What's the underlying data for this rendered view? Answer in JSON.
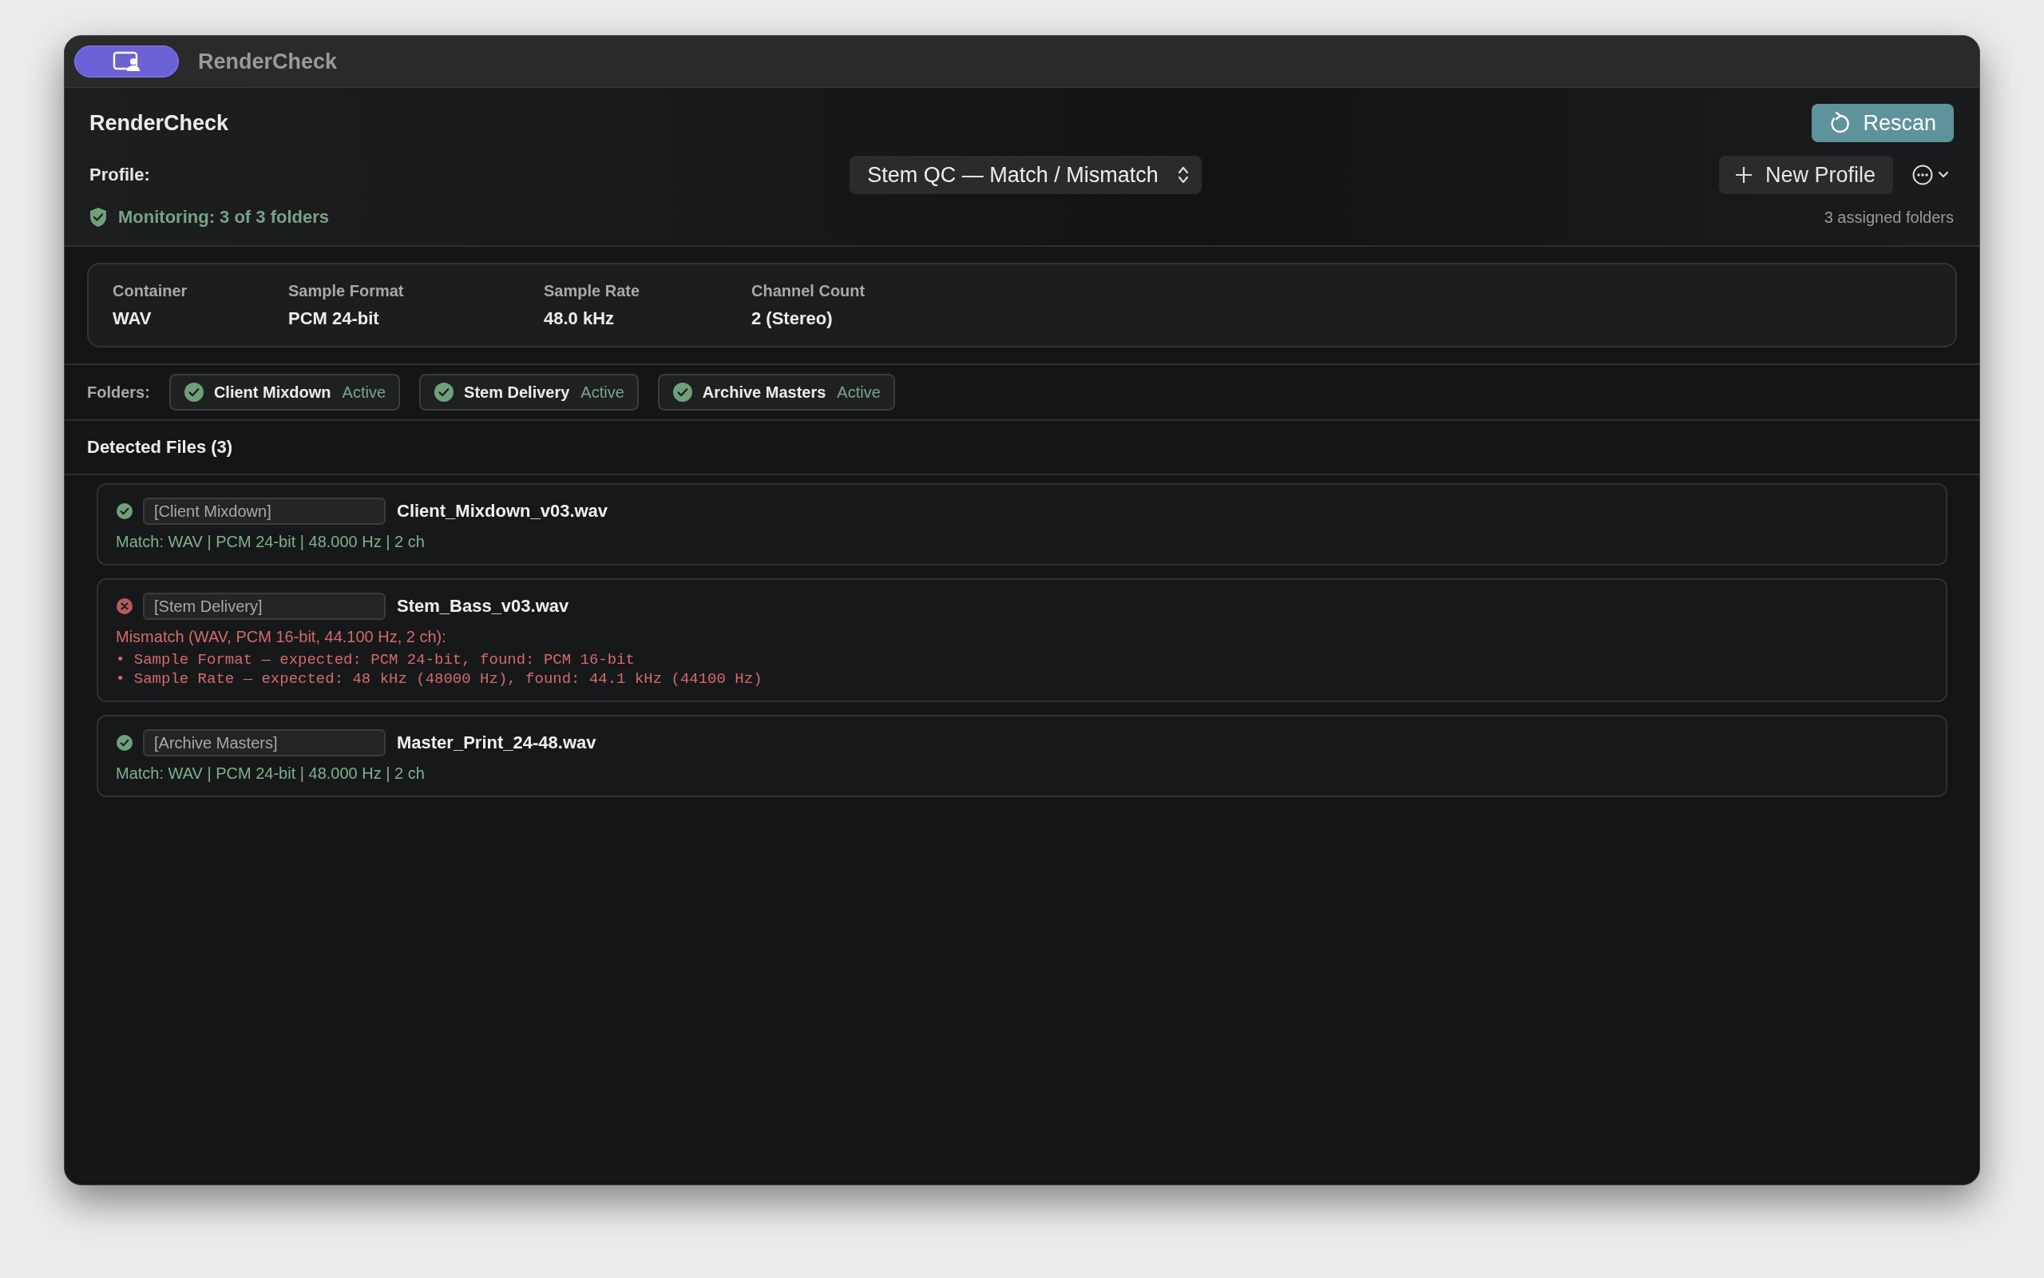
{
  "window": {
    "title": "RenderCheck"
  },
  "header": {
    "title": "RenderCheck",
    "rescan_button": "Rescan",
    "profile_label": "Profile:",
    "profile_select": "Stem QC — Match / Mismatch",
    "new_profile_button": "New Profile",
    "monitoring": "Monitoring: 3 of 3 folders",
    "assigned_count": "3 assigned folders"
  },
  "format": [
    {
      "label": "Container",
      "value": "WAV"
    },
    {
      "label": "Sample Format",
      "value": "PCM 24-bit"
    },
    {
      "label": "Sample Rate",
      "value": "48.0 kHz"
    },
    {
      "label": "Channel Count",
      "value": "2 (Stereo)"
    }
  ],
  "folders": {
    "label": "Folders:",
    "items": [
      {
        "name": "Client Mixdown",
        "status": "Active",
        "active": true
      },
      {
        "name": "Stem Delivery",
        "status": "Active",
        "active": true
      },
      {
        "name": "Archive Masters",
        "status": "Active",
        "active": true
      }
    ]
  },
  "files": {
    "title": "Detected Files (3)",
    "items": [
      {
        "kind": "match",
        "folder": "[Client Mixdown]",
        "name": "Client_Mixdown_v03.wav",
        "summary": "Match: WAV | PCM 24-bit | 48.000 Hz | 2 ch"
      },
      {
        "kind": "mismatch",
        "folder": "[Stem Delivery]",
        "name": "Stem_Bass_v03.wav",
        "summary": "Mismatch (WAV, PCM 16-bit, 44.100 Hz, 2 ch):",
        "details": [
          "• Sample Format — expected: PCM 24-bit, found: PCM 16-bit",
          "• Sample Rate — expected: 48 kHz (48000 Hz), found: 44.1 kHz (44100 Hz)"
        ]
      },
      {
        "kind": "match",
        "folder": "[Archive Masters]",
        "name": "Master_Print_24-48.wav",
        "summary": "Match: WAV | PCM 24-bit | 48.000 Hz | 2 ch"
      }
    ]
  }
}
